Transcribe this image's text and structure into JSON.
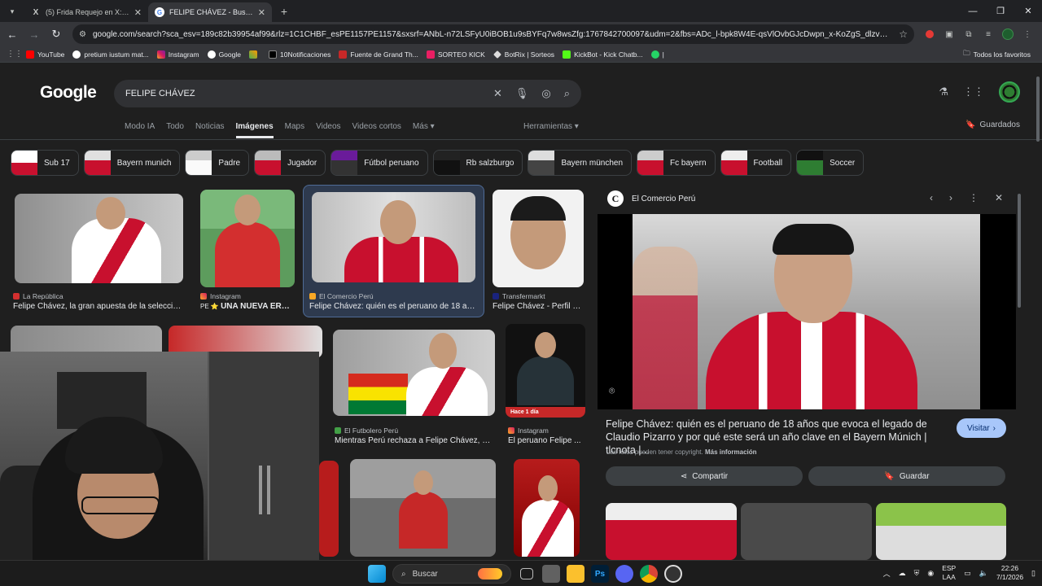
{
  "browser": {
    "tabs": [
      {
        "title": "(5) Frida Requejo en X: \"@crisc",
        "favicon": "x-logo",
        "active": false
      },
      {
        "title": "FELIPE CHÁVEZ - Buscar con Go",
        "favicon": "google-logo",
        "active": true
      }
    ],
    "url": "google.com/search?sca_esv=189c82b39954af99&rlz=1C1CHBF_esPE1157PE1157&sxsrf=ANbL-n72LSFyU0iBOB1u9sBYFq7w8wsZfg:1767842700097&udm=2&fbs=ADc_l-bpk8W4E-qsVlOvbGJcDwpn_x-KoZgS_dlzvUJcCpPvNisF2DcSRPJpJfB...",
    "bookmarks": [
      "YouTube",
      "pretium iustum mat...",
      "Instagram",
      "Google",
      "",
      "10Notificaciones",
      "Fuente de Grand Th...",
      "SORTEO KICK",
      "BotRix | Sorteos",
      "KickBot - Kick Chatb...",
      "|"
    ],
    "all_bookmarks": "Todos los favoritos"
  },
  "google": {
    "logo": "Google",
    "query": "FELIPE CHÁVEZ",
    "nav_tabs": [
      "Modo IA",
      "Todo",
      "Noticias",
      "Imágenes",
      "Maps",
      "Videos",
      "Videos cortos",
      "Más ▾"
    ],
    "active_tab": "Imágenes",
    "tools": "Herramientas ▾",
    "saved": "Guardados",
    "chips": [
      "Sub 17",
      "Bayern munich",
      "Padre",
      "Jugador",
      "Fútbol peruano",
      "Rb salzburgo",
      "Bayern münchen",
      "Fc bayern",
      "Football",
      "Soccer"
    ],
    "results": [
      {
        "source": "La República",
        "caption": "Felipe Chávez, la gran apuesta de la selección..."
      },
      {
        "source": "Instagram",
        "caption": "UNA NUEVA ERA: ..."
      },
      {
        "source": "El Comercio Perú",
        "caption": "Felipe Chávez: quién es el peruano de 18 año..."
      },
      {
        "source": "Transfermarkt",
        "caption": "Felipe Chávez - Perfil d..."
      },
      {
        "source": "El Futbolero Perú",
        "caption": "Mientras Perú rechaza a Felipe Chávez, B..."
      },
      {
        "source": "Instagram",
        "caption": "El peruano Felipe ..."
      }
    ],
    "result_overlay_text": "Hace 1 día"
  },
  "panel": {
    "source": "El Comercio Perú",
    "title": "Felipe Chávez: quién es el peruano de 18 años que evoca el legado de Claudio Pizarro y por qué este será un año clave en el Bayern Múnich | tlcnota |...",
    "visit": "Visitar",
    "copyright": "Las fotos pueden tener copyright.",
    "more_info": "Más información",
    "share": "Compartir",
    "save": "Guardar"
  },
  "taskbar": {
    "search_placeholder": "Buscar",
    "lang_top": "ESP",
    "lang_bottom": "LAA",
    "time": "22:26",
    "date": "7/1/2026"
  },
  "colors": {
    "page_bg": "#1f1f1f",
    "accent_button": "#a8c7fa",
    "jersey_red": "#c8102e"
  }
}
